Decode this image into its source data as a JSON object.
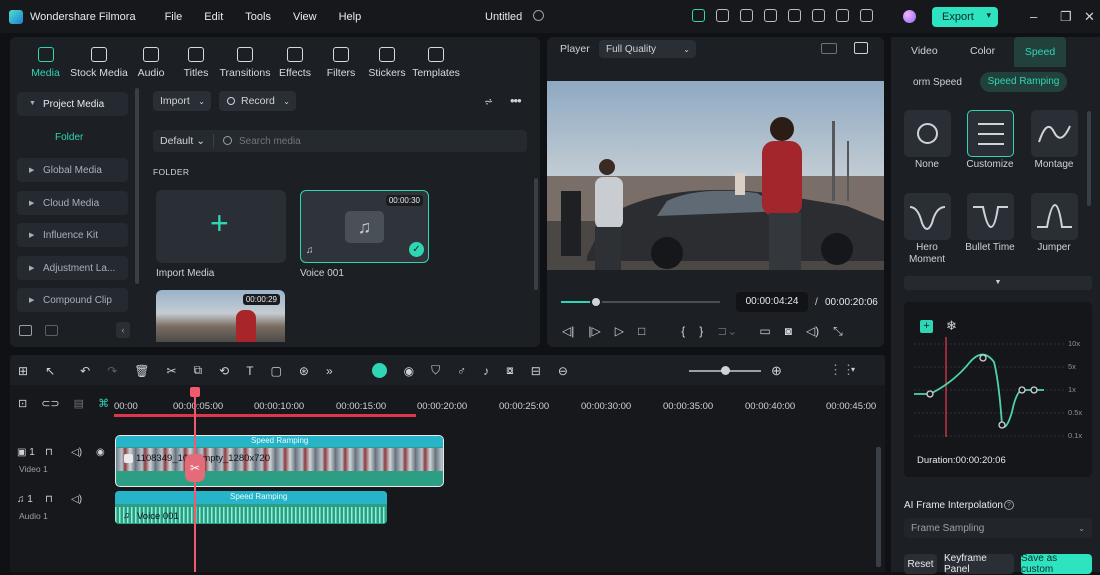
{
  "app": {
    "name": "Wondershare Filmora",
    "doc_title": "Untitled",
    "accent": "#2fd6b4"
  },
  "menu": [
    "File",
    "Edit",
    "Tools",
    "View",
    "Help"
  ],
  "export_label": "Export",
  "media_tabs": [
    "Media",
    "Stock Media",
    "Audio",
    "Titles",
    "Transitions",
    "Effects",
    "Filters",
    "Stickers",
    "Templates"
  ],
  "left_nav": {
    "project_media": "Project Media",
    "folder": "Folder",
    "items": [
      "Global Media",
      "Cloud Media",
      "Influence Kit",
      "Adjustment La...",
      "Compound Clip"
    ]
  },
  "media": {
    "import": "Import",
    "record": "Record",
    "sort": "Default",
    "search_placeholder": "Search media",
    "folder_heading": "FOLDER",
    "import_media": "Import Media",
    "voice_clip": "Voice 001",
    "voice_duration": "00:00:30",
    "video_duration": "00:00:29"
  },
  "player": {
    "label": "Player",
    "quality": "Full Quality",
    "current_time": "00:00:04:24",
    "separator": "/",
    "total_time": "00:00:20:06",
    "progress": 0.22
  },
  "timeline": {
    "ruler": [
      "00:00",
      "00:00:05:00",
      "00:00:10:00",
      "00:00:15:00",
      "00:00:20:00",
      "00:00:25:00",
      "00:00:30:00",
      "00:00:35:00",
      "00:00:40:00",
      "00:00:45:00"
    ],
    "video_track": {
      "number": "1",
      "name": "Video 1",
      "clip_badge": "Speed Ramping",
      "clip_title": "1108349_10...Empty_1280x720"
    },
    "audio_track": {
      "number": "1",
      "name": "Audio 1",
      "clip_badge": "Speed Ramping",
      "clip_title": "Voice 001"
    }
  },
  "right_panel": {
    "tabs": [
      "Video",
      "Color",
      "Speed"
    ],
    "subtabs": [
      "orm Speed",
      "Speed Ramping"
    ],
    "presets": [
      "None",
      "Customize",
      "Montage",
      "Hero Moment",
      "Bullet Time",
      "Jumper"
    ],
    "graph_labels": [
      "10x",
      "5x",
      "1x",
      "0.5x",
      "0.1x"
    ],
    "duration": "Duration:00:00:20:06",
    "ai_label": "AI Frame Interpolation",
    "frame_sampling": "Frame Sampling",
    "reset": "Reset",
    "keyframe": "Keyframe Panel",
    "save": "Save as custom"
  }
}
